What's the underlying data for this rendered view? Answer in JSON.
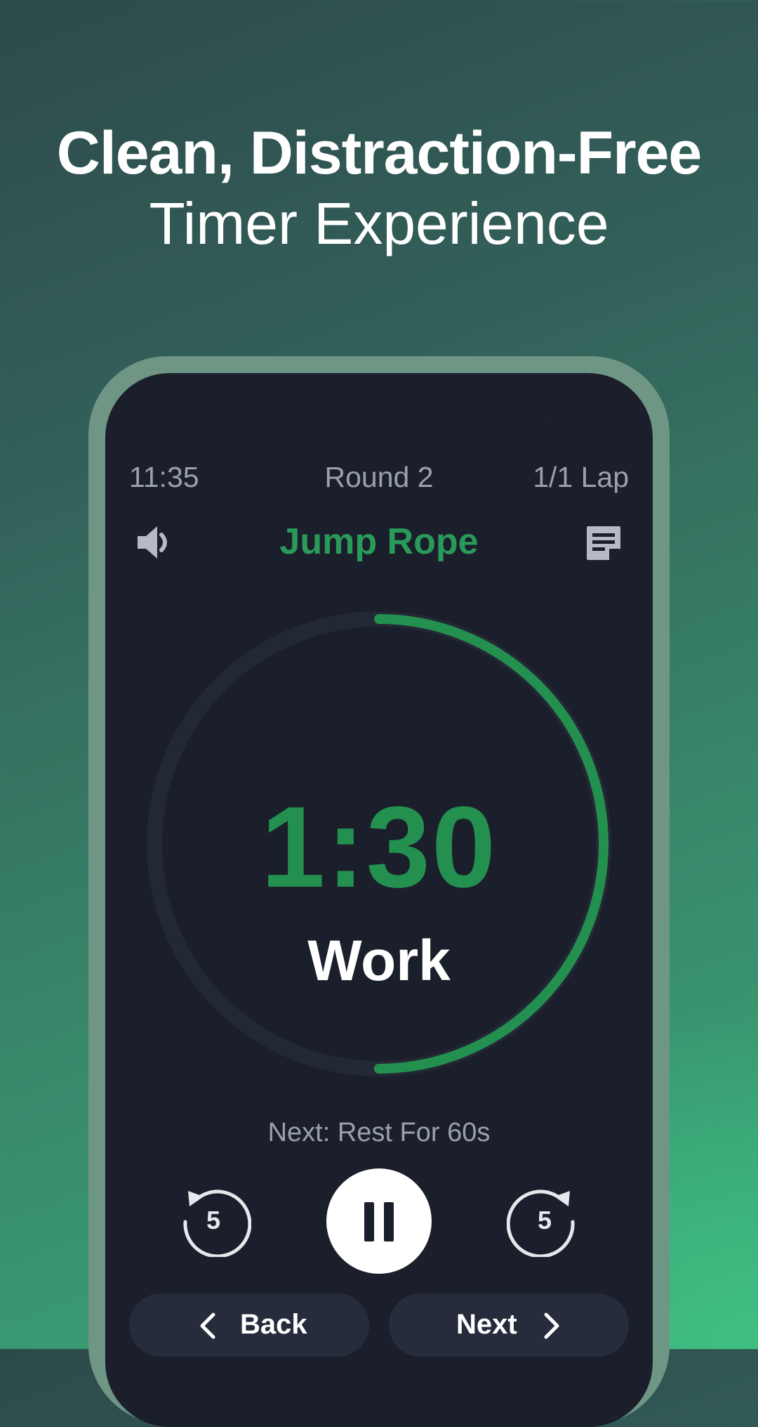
{
  "headline": {
    "line1": "Clean, Distraction-Free",
    "line2": "Timer Experience"
  },
  "status_bar": {
    "time": "11:35",
    "round": "Round 2",
    "lap": "1/1 Lap"
  },
  "exercise_name": "Jump Rope",
  "timer": {
    "remaining": "1:30",
    "phase": "Work",
    "progress": 0.5
  },
  "next_info": "Next: Rest For 60s",
  "controls": {
    "skip_back_seconds": "5",
    "skip_forward_seconds": "5",
    "back_label": "Back",
    "next_label": "Next"
  },
  "icons": {
    "sound": "speaker-icon",
    "notes": "notes-icon",
    "pause": "pause-icon",
    "rewind": "rewind-5-icon",
    "forward": "forward-5-icon"
  },
  "colors": {
    "accent_green": "#2a9a59",
    "screen_bg": "#1b1f2b",
    "muted_text": "#9aa0ad",
    "button_bg": "#262c3b"
  }
}
